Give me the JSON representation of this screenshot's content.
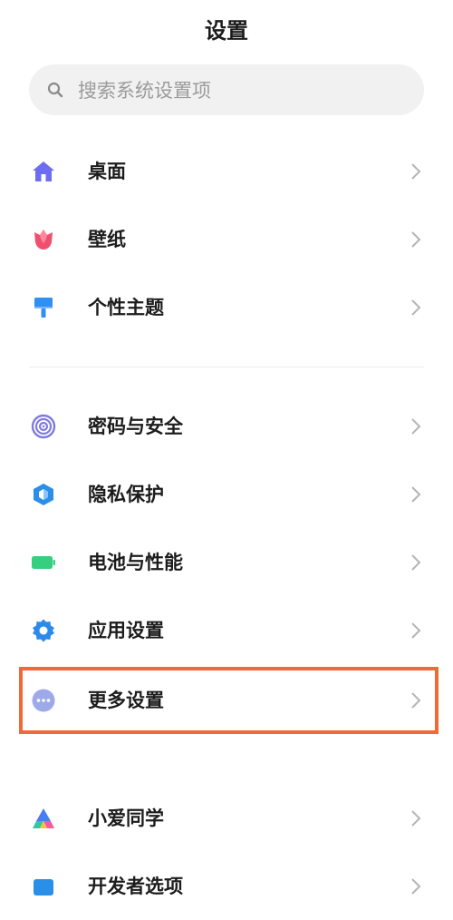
{
  "header": {
    "title": "设置"
  },
  "search": {
    "placeholder": "搜索系统设置项"
  },
  "groups": [
    {
      "items": [
        {
          "label": "桌面",
          "icon": "home-icon",
          "color": "#6e6cf0"
        },
        {
          "label": "壁纸",
          "icon": "tulip-icon",
          "color": "#f0506e"
        },
        {
          "label": "个性主题",
          "icon": "paintbrush-icon",
          "color": "#2f8ff2"
        }
      ]
    },
    {
      "items": [
        {
          "label": "密码与安全",
          "icon": "fingerprint-icon",
          "color": "#7f7bdc"
        },
        {
          "label": "隐私保护",
          "icon": "privacy-shield-icon",
          "color": "#2b8fe8"
        },
        {
          "label": "电池与性能",
          "icon": "battery-icon",
          "color": "#35cf7f"
        },
        {
          "label": "应用设置",
          "icon": "gear-icon",
          "color": "#2d8ae9"
        },
        {
          "label": "更多设置",
          "icon": "more-dots-icon",
          "color": "#9ea9ea"
        }
      ]
    },
    {
      "items": [
        {
          "label": "小爱同学",
          "icon": "xiaoai-icon",
          "color": "#4a7df0"
        },
        {
          "label": "开发者选项",
          "icon": "code-icon",
          "color": "#2b8fe8"
        }
      ]
    }
  ],
  "highlight": {
    "target": "更多设置",
    "color": "#f06a35"
  }
}
